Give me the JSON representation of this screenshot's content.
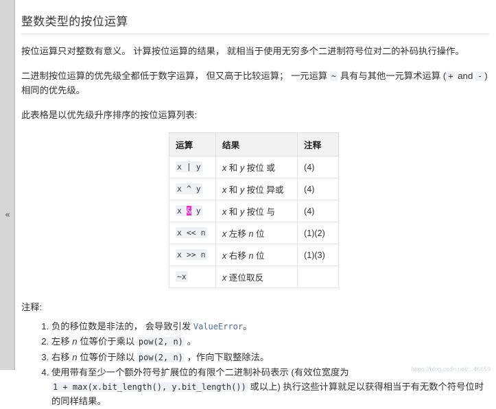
{
  "sidebar": {
    "collapse_handle": "«"
  },
  "page": {
    "title": "整数类型的按位运算",
    "paragraph1": "按位运算只对整数有意义。 计算按位运算的结果， 就相当于使用无穷多个二进制符号位对二的补码执行操作。",
    "paragraph2_part1": "二进制按位运算的优先级全都低于数字运算， 但又高于比较运算； 一元运算 ",
    "paragraph2_code_tilde": "~",
    "paragraph2_part2": " 具有与其他一元算术运算 (",
    "paragraph2_code_plus": "+",
    "paragraph2_part3": " and ",
    "paragraph2_code_minus": "-",
    "paragraph2_part4": ")相同的优先级。",
    "paragraph3": "此表格是以优先级升序排序的按位运算列表:",
    "notes_label": "注释:",
    "watermark": "https://blog.csdn.net/...46659"
  },
  "table": {
    "headers": {
      "operation": "运算",
      "result": "结果",
      "note": "注释"
    },
    "rows": [
      {
        "op_pre": "x | y",
        "op_html_left": "x ",
        "op_symbol": "|",
        "op_html_right": " y",
        "selected": false,
        "result_prefix": "x",
        "result_mid": " 和 ",
        "result_var2": "y",
        "result_suffix": " 按位 ",
        "result_tail": "或",
        "note": "(4)"
      },
      {
        "op_pre": "x ^ y",
        "op_html_left": "x ",
        "op_symbol": "^",
        "op_html_right": " y",
        "selected": false,
        "result_prefix": "x",
        "result_mid": " 和 ",
        "result_var2": "y",
        "result_suffix": " 按位 ",
        "result_tail": "异或",
        "note": "(4)"
      },
      {
        "op_pre": "x & y",
        "op_html_left": "x ",
        "op_symbol": "&",
        "op_html_right": " y",
        "selected": true,
        "result_prefix": "x",
        "result_mid": " 和 ",
        "result_var2": "y",
        "result_suffix": " 按位 ",
        "result_tail": "与",
        "note": "(4)"
      },
      {
        "op_pre": "x << n",
        "op_html_left": "x ",
        "op_symbol": "<<",
        "op_html_right": " n",
        "selected": false,
        "result_prefix": "x",
        "result_mid": " 左移 ",
        "result_var2": "n",
        "result_suffix": " 位",
        "result_tail": "",
        "note": "(1)(2)"
      },
      {
        "op_pre": "x >> n",
        "op_html_left": "x ",
        "op_symbol": ">>",
        "op_html_right": " n",
        "selected": false,
        "result_prefix": "x",
        "result_mid": " 右移 ",
        "result_var2": "n",
        "result_suffix": " 位",
        "result_tail": "",
        "note": "(1)(3)"
      },
      {
        "op_pre": "~x",
        "op_html_left": "",
        "op_symbol": "~x",
        "op_html_right": "",
        "selected": false,
        "result_prefix": "x",
        "result_mid": " 逐位取反",
        "result_var2": "",
        "result_suffix": "",
        "result_tail": "",
        "note": ""
      }
    ]
  },
  "notes": {
    "note1_part1": "负的移位数是非法的， 会导致引发 ",
    "note1_link": "ValueError",
    "note1_part2": "。",
    "note2_part1": "左移 ",
    "note2_var": "n",
    "note2_part2": " 位等价于乘以 ",
    "note2_code": "pow(2, n)",
    "note2_part3": " 。",
    "note3_part1": "右移 ",
    "note3_var": "n",
    "note3_part2": " 位等价于除以 ",
    "note3_code": "pow(2, n)",
    "note3_part3": " ，作向下取整除法。",
    "note4_part1": "使用带有至少一个额外符号扩展位的有限个二进制补码表示 (有效位宽度为 ",
    "note4_code1": "1 + max(x.bit_length(), y.bit_length())",
    "note4_part2": " 或以上) 执行这些计算就足以获得相当于有无数个符号位时的同样结果。"
  }
}
